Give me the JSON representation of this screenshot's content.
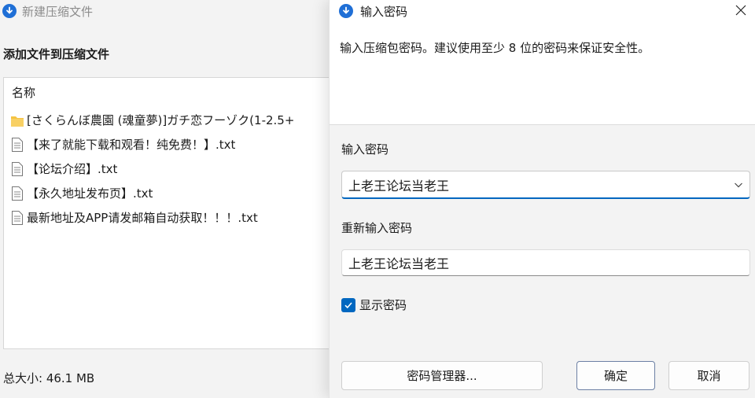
{
  "background_window": {
    "title": "新建压缩文件",
    "heading": "添加文件到压缩文件",
    "file_list": {
      "column_header": "名称",
      "items": [
        {
          "icon": "folder-icon",
          "name": "[さくらんぼ農園 (魂童夢)]ガチ恋フーゾク(1-2.5+"
        },
        {
          "icon": "text-file-icon",
          "name": "【来了就能下载和观看！纯免费！】.txt"
        },
        {
          "icon": "text-file-icon",
          "name": "【论坛介绍】.txt"
        },
        {
          "icon": "text-file-icon",
          "name": "【永久地址发布页】.txt"
        },
        {
          "icon": "text-file-icon",
          "name": "最新地址及APP请发邮箱自动获取！！！.txt"
        }
      ]
    },
    "total_size": "总大小: 46.1 MB"
  },
  "dialog": {
    "title": "输入密码",
    "description": "输入压缩包密码。建议使用至少 8 位的密码来保证安全性。",
    "password_label": "输入密码",
    "password_value": "上老王论坛当老王",
    "reenter_label": "重新输入密码",
    "reenter_value": "上老王论坛当老王",
    "show_password": {
      "label": "显示密码",
      "checked": true
    },
    "buttons": {
      "password_manager": "密码管理器...",
      "ok": "确定",
      "cancel": "取消"
    }
  },
  "colors": {
    "accent": "#0067c0",
    "app_icon": "#1f6fd6",
    "folder": "#f5c342"
  }
}
